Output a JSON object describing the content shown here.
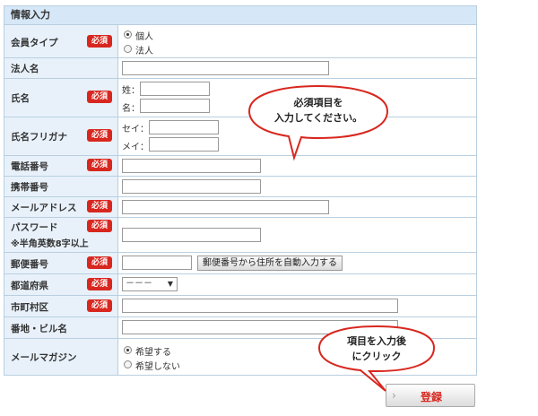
{
  "header": {
    "title": "情報入力"
  },
  "required_badge": "必須",
  "rows": {
    "member_type": {
      "label": "会員タイプ",
      "options": [
        "個人",
        "法人"
      ],
      "selected": "個人"
    },
    "company": {
      "label": "法人名"
    },
    "name": {
      "label": "氏名",
      "sei": "姓：",
      "mei": "名："
    },
    "furigana": {
      "label": "氏名フリガナ",
      "sei": "セイ：",
      "mei": "メイ："
    },
    "phone": {
      "label": "電話番号"
    },
    "mobile": {
      "label": "携帯番号"
    },
    "email": {
      "label": "メールアドレス"
    },
    "password": {
      "label": "パスワード",
      "note": "※半角英数8字以上"
    },
    "zip": {
      "label": "郵便番号",
      "button": "郵便番号から住所を自動入力する"
    },
    "prefecture": {
      "label": "都道府県",
      "value": "－－－"
    },
    "city": {
      "label": "市町村区"
    },
    "address": {
      "label": "番地・ビル名"
    },
    "newsletter": {
      "label": "メールマガジン",
      "options": [
        "希望する",
        "希望しない"
      ],
      "selected": "希望する"
    }
  },
  "submit": {
    "label": "登録"
  },
  "callouts": {
    "required_tip": {
      "line1": "必須項目を",
      "line2": "入力してください。"
    },
    "click_tip": {
      "line1": "項目を入力後",
      "line2": "にクリック"
    }
  },
  "colors": {
    "required_badge": "#d8271f",
    "header_bg": "#d6e7f7",
    "label_bg": "#e8f1fa",
    "border": "#b9cfe0"
  }
}
